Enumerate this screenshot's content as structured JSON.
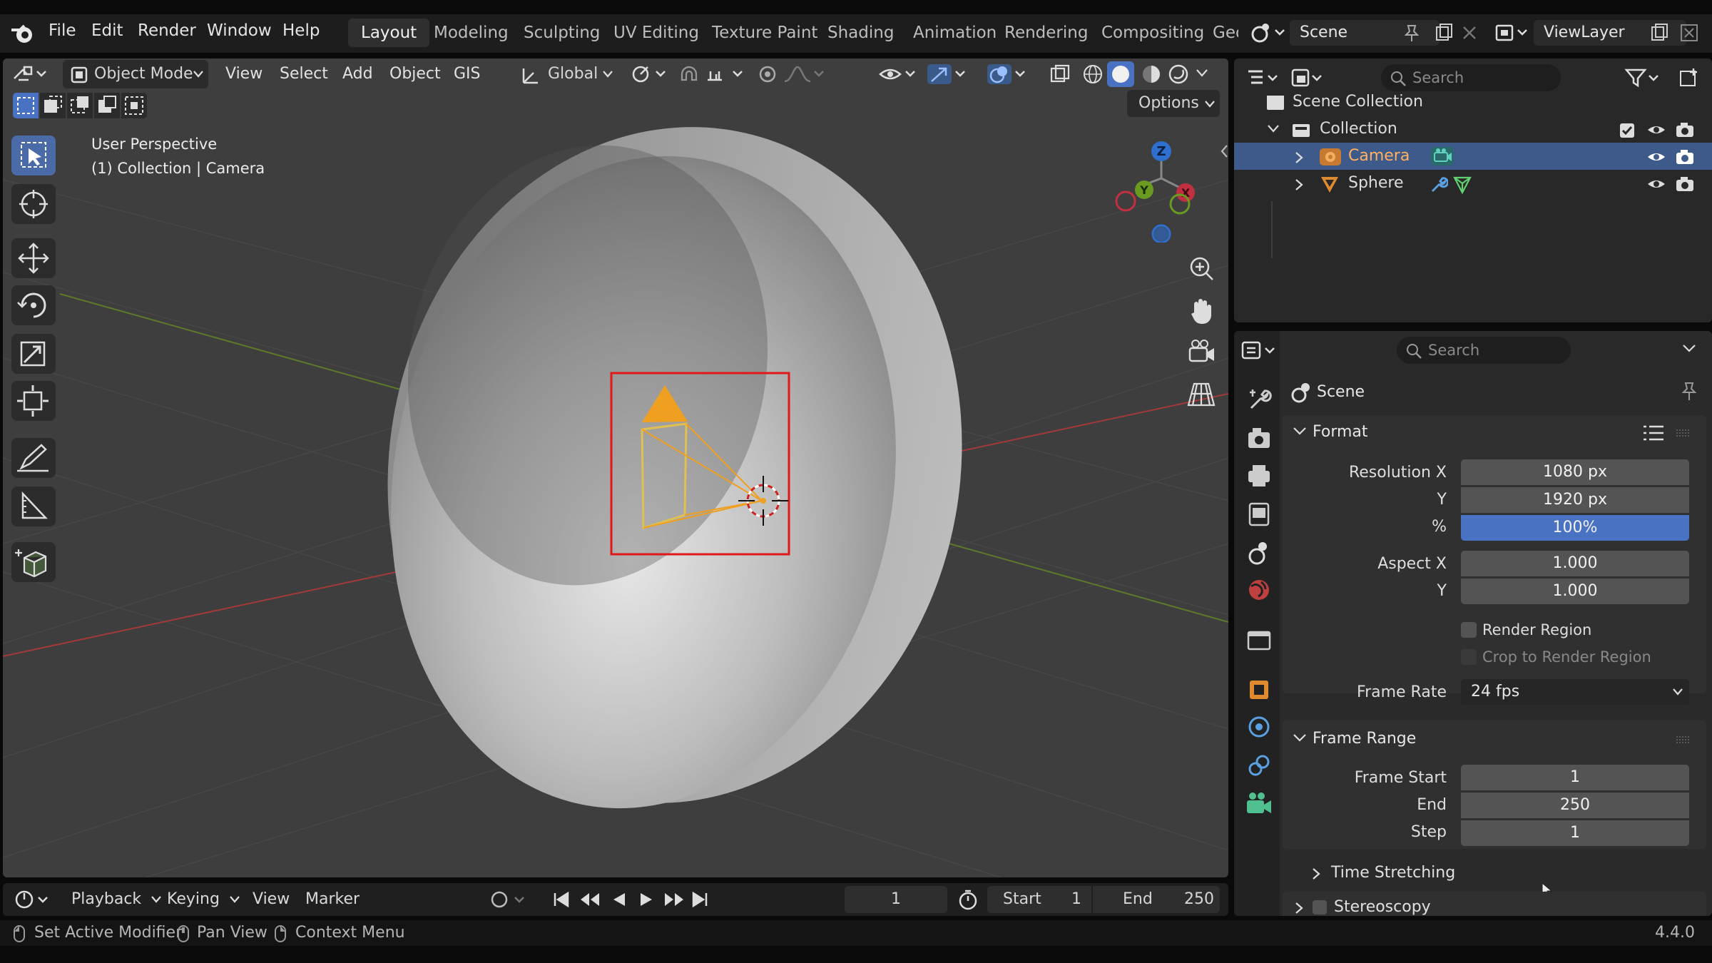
{
  "menu": {
    "items": [
      "File",
      "Edit",
      "Render",
      "Window",
      "Help"
    ],
    "workspaces": [
      "Layout",
      "Modeling",
      "Sculpting",
      "UV Editing",
      "Texture Paint",
      "Shading",
      "Animation",
      "Rendering",
      "Compositing",
      "Geo"
    ],
    "active_workspace": "Layout",
    "scene_name": "Scene",
    "view_layer_name": "ViewLayer"
  },
  "viewport": {
    "mode": "Object Mode",
    "header_menus": [
      "View",
      "Select",
      "Add",
      "Object",
      "GIS"
    ],
    "orientation": "Global",
    "options_label": "Options",
    "overlay_line1": "User Perspective",
    "overlay_line2": "(1) Collection | Camera",
    "gizmo_axes": [
      "Z",
      "Y",
      "X"
    ]
  },
  "outliner": {
    "search_placeholder": "Search",
    "scene_collection": "Scene Collection",
    "collection": "Collection",
    "objects": [
      {
        "name": "Camera",
        "selected": true
      },
      {
        "name": "Sphere",
        "selected": false
      }
    ]
  },
  "properties": {
    "search_placeholder": "Search",
    "context": "Scene",
    "format": {
      "title": "Format",
      "resolution_x_label": "Resolution X",
      "resolution_x": "1080 px",
      "resolution_y_label": "Y",
      "resolution_y": "1920 px",
      "percent_label": "%",
      "percent": "100%",
      "aspect_x_label": "Aspect X",
      "aspect_x": "1.000",
      "aspect_y_label": "Y",
      "aspect_y": "1.000",
      "render_region": "Render Region",
      "crop_region": "Crop to Render Region",
      "frame_rate_label": "Frame Rate",
      "frame_rate": "24 fps"
    },
    "frame_range": {
      "title": "Frame Range",
      "start_label": "Frame Start",
      "start": "1",
      "end_label": "End",
      "end": "250",
      "step_label": "Step",
      "step": "1"
    },
    "time_stretching": "Time Stretching",
    "stereoscopy": "Stereoscopy"
  },
  "timeline": {
    "menus": [
      "Playback",
      "Keying",
      "View",
      "Marker"
    ],
    "current_frame": "1",
    "start_label": "Start",
    "start": "1",
    "end_label": "End",
    "end": "250"
  },
  "status": {
    "items": [
      "Set Active Modifier",
      "Pan View",
      "Context Menu"
    ],
    "version": "4.4.0"
  },
  "colors": {
    "accent_blue": "#4a72c2",
    "selection_orange": "#f0a020",
    "region_red": "#e01818"
  }
}
